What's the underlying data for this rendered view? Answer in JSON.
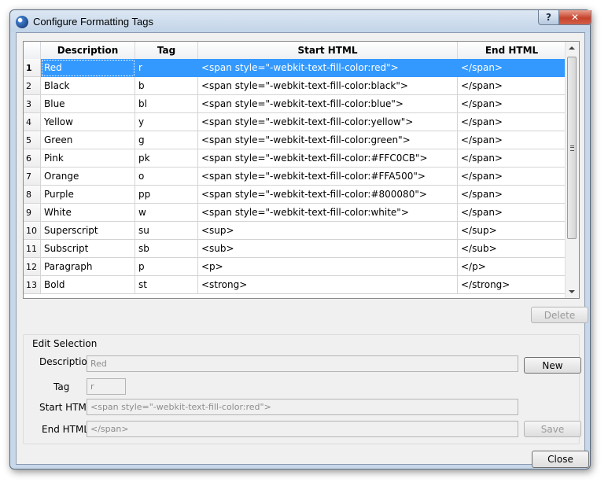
{
  "window": {
    "title": "Configure Formatting Tags",
    "help_label": "?",
    "close_label": "✕"
  },
  "table": {
    "headers": [
      "",
      "Description",
      "Tag",
      "Start HTML",
      "End HTML"
    ],
    "rows": [
      {
        "n": "1",
        "desc": "Red",
        "tag": "r",
        "start": "<span style=\"-webkit-text-fill-color:red\">",
        "end": "</span>"
      },
      {
        "n": "2",
        "desc": "Black",
        "tag": "b",
        "start": "<span style=\"-webkit-text-fill-color:black\">",
        "end": "</span>"
      },
      {
        "n": "3",
        "desc": "Blue",
        "tag": "bl",
        "start": "<span style=\"-webkit-text-fill-color:blue\">",
        "end": "</span>"
      },
      {
        "n": "4",
        "desc": "Yellow",
        "tag": "y",
        "start": "<span style=\"-webkit-text-fill-color:yellow\">",
        "end": "</span>"
      },
      {
        "n": "5",
        "desc": "Green",
        "tag": "g",
        "start": "<span style=\"-webkit-text-fill-color:green\">",
        "end": "</span>"
      },
      {
        "n": "6",
        "desc": "Pink",
        "tag": "pk",
        "start": "<span style=\"-webkit-text-fill-color:#FFC0CB\">",
        "end": "</span>"
      },
      {
        "n": "7",
        "desc": "Orange",
        "tag": "o",
        "start": "<span style=\"-webkit-text-fill-color:#FFA500\">",
        "end": "</span>"
      },
      {
        "n": "8",
        "desc": "Purple",
        "tag": "pp",
        "start": "<span style=\"-webkit-text-fill-color:#800080\">",
        "end": "</span>"
      },
      {
        "n": "9",
        "desc": "White",
        "tag": "w",
        "start": "<span style=\"-webkit-text-fill-color:white\">",
        "end": "</span>"
      },
      {
        "n": "10",
        "desc": "Superscript",
        "tag": "su",
        "start": "<sup>",
        "end": "</sup>"
      },
      {
        "n": "11",
        "desc": "Subscript",
        "tag": "sb",
        "start": "<sub>",
        "end": "</sub>"
      },
      {
        "n": "12",
        "desc": "Paragraph",
        "tag": "p",
        "start": "<p>",
        "end": "</p>"
      },
      {
        "n": "13",
        "desc": "Bold",
        "tag": "st",
        "start": "<strong>",
        "end": "</strong>"
      }
    ],
    "selected_index": 0
  },
  "buttons": {
    "delete": "Delete",
    "new": "New",
    "save": "Save",
    "close": "Close"
  },
  "edit": {
    "group_label": "Edit Selection",
    "description_label": "Description",
    "tag_label": "Tag",
    "start_label": "Start HTML",
    "end_label": "End HTML",
    "description_value": "Red",
    "tag_value": "r",
    "start_value": "<span style=\"-webkit-text-fill-color:red\">",
    "end_value": "</span>"
  },
  "colors": {
    "selection": "#3399ff",
    "frame": "#c8d8ea",
    "close_button": "#c6422b"
  }
}
